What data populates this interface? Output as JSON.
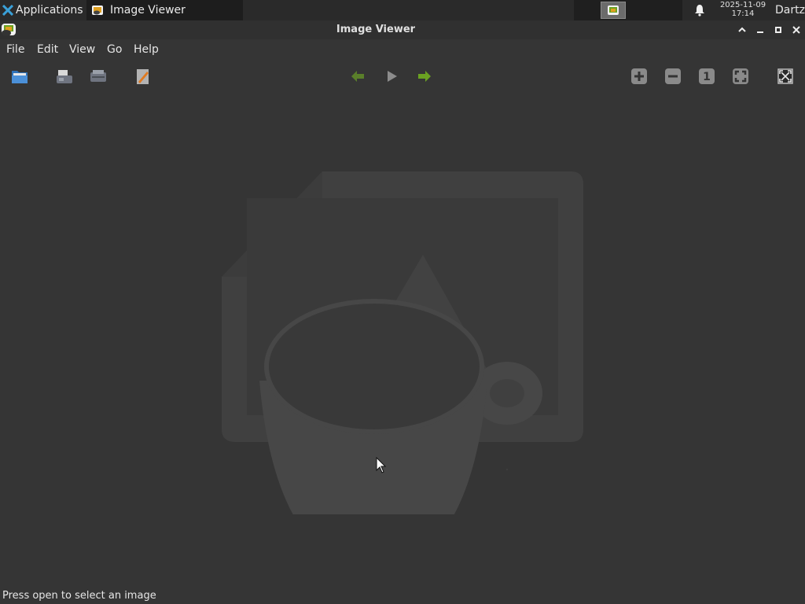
{
  "panel": {
    "apps_label": "Applications",
    "task_label": "Image Viewer",
    "clock_date": "2025-11-09",
    "clock_time": "17:14",
    "user": "Dartz"
  },
  "window": {
    "title": "Image Viewer"
  },
  "menu": [
    "File",
    "Edit",
    "View",
    "Go",
    "Help"
  ],
  "toolbar_icons": [
    "open-folder-icon",
    "save-icon",
    "print-icon",
    "edit-icon",
    "back-arrow-icon",
    "play-icon",
    "forward-arrow-icon",
    "zoom-in-icon",
    "zoom-out-icon",
    "zoom-100-icon",
    "zoom-fit-icon",
    "fullscreen-icon"
  ],
  "toolbar": {
    "zoom_one_label": "1"
  },
  "status": {
    "text": "Press open to select an image"
  },
  "colors": {
    "panel": "#2a2a2a",
    "window_bg": "#353535",
    "accent_green": "#6aa122",
    "placeholder": "#454545"
  }
}
